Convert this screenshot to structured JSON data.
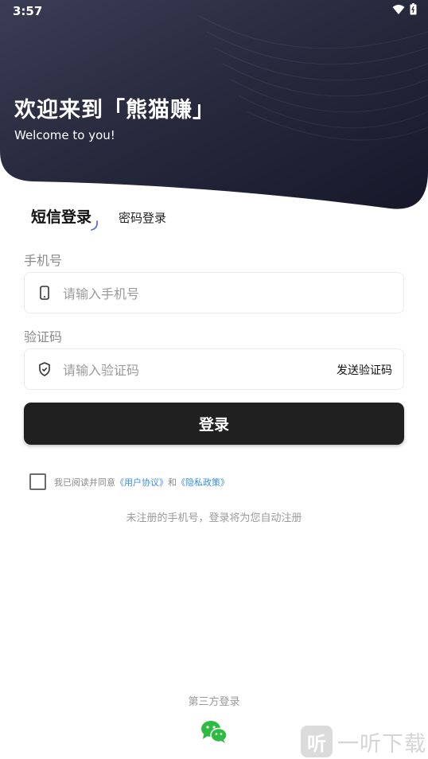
{
  "status_bar": {
    "time": "3:57"
  },
  "header": {
    "title": "欢迎来到「熊猫赚」",
    "subtitle": "Welcome to you!"
  },
  "tabs": [
    {
      "label": "短信登录",
      "active": true
    },
    {
      "label": "密码登录",
      "active": false
    }
  ],
  "phone": {
    "label": "手机号",
    "placeholder": "请输入手机号",
    "value": ""
  },
  "code": {
    "label": "验证码",
    "placeholder": "请输入验证码",
    "value": "",
    "send_label": "发送验证码"
  },
  "login_button": "登录",
  "agreement": {
    "prefix": "我已阅读并同意",
    "user_agreement": "《用户协议》",
    "and": "和",
    "privacy_policy": "《隐私政策》",
    "checked": false
  },
  "auto_register_hint": "未注册的手机号，登录将为您自动注册",
  "third_party": {
    "title": "第三方登录",
    "icons": [
      "wechat-icon"
    ]
  },
  "watermark": {
    "badge": "听",
    "text": "一听下载"
  },
  "colors": {
    "header_dark": "#1e2032",
    "button": "#202020",
    "link": "#3a8ee6"
  }
}
